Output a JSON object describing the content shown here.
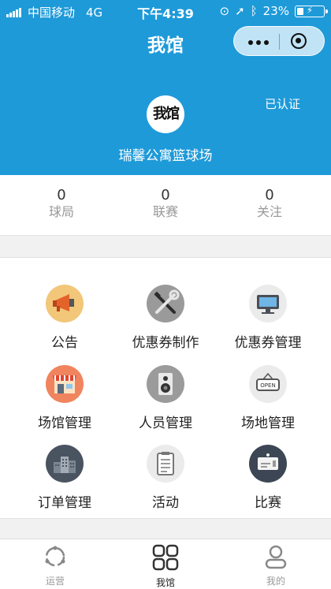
{
  "status_bar": {
    "carrier": "中国移动",
    "network": "4G",
    "time": "下午4:39",
    "battery": "23%"
  },
  "nav": {
    "title": "我馆"
  },
  "profile": {
    "verified": "已认证",
    "logo_text": "我馆",
    "venue_name": "瑞馨公寓篮球场"
  },
  "stats": [
    {
      "value": "0",
      "label": "球局"
    },
    {
      "value": "0",
      "label": "联赛"
    },
    {
      "value": "0",
      "label": "关注"
    }
  ],
  "menu": [
    {
      "label": "公告",
      "icon": "megaphone-icon"
    },
    {
      "label": "优惠券制作",
      "icon": "tools-icon"
    },
    {
      "label": "优惠券管理",
      "icon": "monitor-icon"
    },
    {
      "label": "场馆管理",
      "icon": "storefront-icon"
    },
    {
      "label": "人员管理",
      "icon": "speaker-icon"
    },
    {
      "label": "场地管理",
      "icon": "open-sign-icon"
    },
    {
      "label": "订单管理",
      "icon": "buildings-icon"
    },
    {
      "label": "活动",
      "icon": "clipboard-icon"
    },
    {
      "label": "比赛",
      "icon": "ticket-icon"
    }
  ],
  "tabs": [
    {
      "label": "运营",
      "icon": "operation-icon"
    },
    {
      "label": "我馆",
      "icon": "grid-icon",
      "active": true
    },
    {
      "label": "我的",
      "icon": "person-icon"
    }
  ]
}
